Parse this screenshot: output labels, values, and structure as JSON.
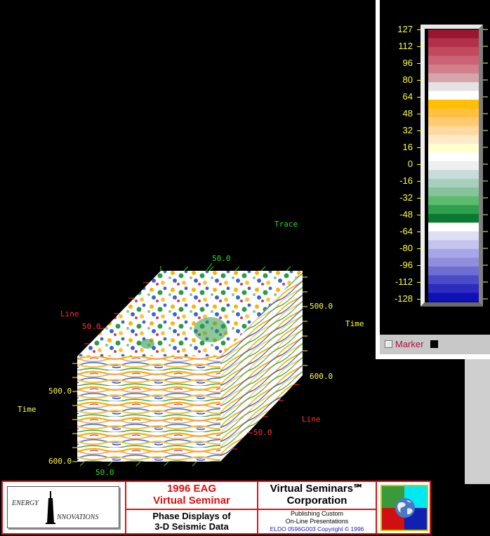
{
  "plot": {
    "axis_labels": {
      "trace": "Trace",
      "line_left": "Line",
      "line_right": "Line",
      "time_left": "Time",
      "time_right": "Time"
    },
    "ticks": {
      "trace_top": "50.0",
      "line_top_left": "50.0",
      "time_right_500": "500.0",
      "time_right_600": "600.0",
      "time_left_500": "500.0",
      "time_left_600": "600.0",
      "line_right_50": "50.0",
      "trace_bottom": "50.0"
    },
    "colors": {
      "trace_axis": "#20e020",
      "time_axis": "#ffff40",
      "line_axis": "#ff3030"
    }
  },
  "colorbar": {
    "ticks": [
      "127",
      "112",
      "96",
      "80",
      "64",
      "48",
      "32",
      "16",
      "0",
      "-16",
      "-32",
      "-48",
      "-64",
      "-80",
      "-96",
      "-112",
      "-128"
    ],
    "swatches": [
      "#9a1530",
      "#b3304a",
      "#c24a5e",
      "#cc6274",
      "#d27f8c",
      "#d7a4ac",
      "#e6e2e4",
      "#ffffff",
      "#ffbe00",
      "#ffc040",
      "#ffcb70",
      "#ffd9a0",
      "#ffe9c8",
      "#ffffd0",
      "#ffffff",
      "#eef0f0",
      "#c9dcdc",
      "#a7cfbf",
      "#86c39b",
      "#5dbb6e",
      "#2fa04e",
      "#0a7a32",
      "#ffffff",
      "#dedef4",
      "#c4c4ee",
      "#a7a7e8",
      "#8f8fdc",
      "#6d6dd2",
      "#4b4bc8",
      "#2c2cc0",
      "#1010b8"
    ],
    "marker_label": "Marker"
  },
  "banner": {
    "logo_text_top": "ENERGY",
    "logo_text_bottom": "NNOVATIONS",
    "event_year": "1996 EAG",
    "event_name": "Virtual Seminar",
    "title_line1": "Phase Displays of",
    "title_line2": "3-D Seismic Data",
    "company_line1": "Virtual Seminars℠",
    "company_line2": "Corporation",
    "tagline1": "Publishing Custom",
    "tagline2": "On-Line Presentations",
    "copyright": "ELDO 0596G003 Copyright © 1996"
  }
}
